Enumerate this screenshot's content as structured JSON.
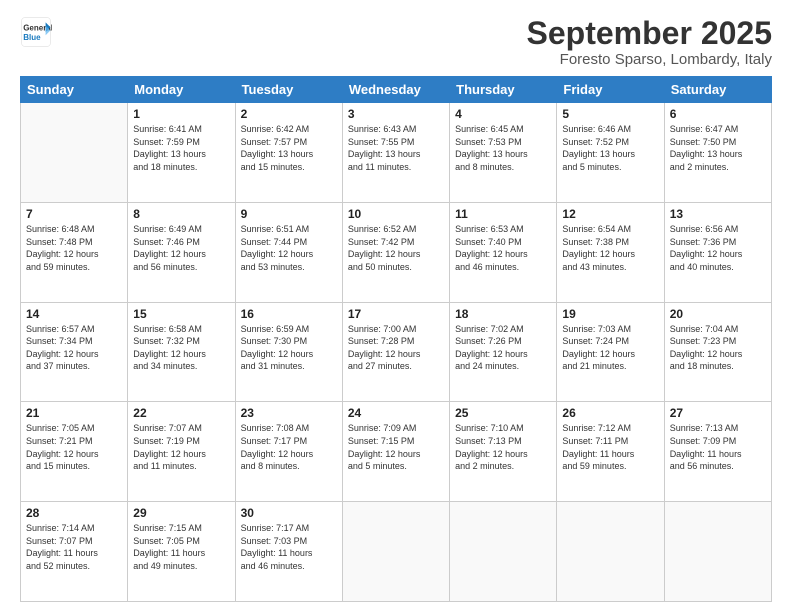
{
  "logo": {
    "text_general": "General",
    "text_blue": "Blue"
  },
  "header": {
    "title": "September 2025",
    "subtitle": "Foresto Sparso, Lombardy, Italy"
  },
  "weekdays": [
    "Sunday",
    "Monday",
    "Tuesday",
    "Wednesday",
    "Thursday",
    "Friday",
    "Saturday"
  ],
  "weeks": [
    [
      {
        "day": "",
        "info": ""
      },
      {
        "day": "1",
        "info": "Sunrise: 6:41 AM\nSunset: 7:59 PM\nDaylight: 13 hours\nand 18 minutes."
      },
      {
        "day": "2",
        "info": "Sunrise: 6:42 AM\nSunset: 7:57 PM\nDaylight: 13 hours\nand 15 minutes."
      },
      {
        "day": "3",
        "info": "Sunrise: 6:43 AM\nSunset: 7:55 PM\nDaylight: 13 hours\nand 11 minutes."
      },
      {
        "day": "4",
        "info": "Sunrise: 6:45 AM\nSunset: 7:53 PM\nDaylight: 13 hours\nand 8 minutes."
      },
      {
        "day": "5",
        "info": "Sunrise: 6:46 AM\nSunset: 7:52 PM\nDaylight: 13 hours\nand 5 minutes."
      },
      {
        "day": "6",
        "info": "Sunrise: 6:47 AM\nSunset: 7:50 PM\nDaylight: 13 hours\nand 2 minutes."
      }
    ],
    [
      {
        "day": "7",
        "info": "Sunrise: 6:48 AM\nSunset: 7:48 PM\nDaylight: 12 hours\nand 59 minutes."
      },
      {
        "day": "8",
        "info": "Sunrise: 6:49 AM\nSunset: 7:46 PM\nDaylight: 12 hours\nand 56 minutes."
      },
      {
        "day": "9",
        "info": "Sunrise: 6:51 AM\nSunset: 7:44 PM\nDaylight: 12 hours\nand 53 minutes."
      },
      {
        "day": "10",
        "info": "Sunrise: 6:52 AM\nSunset: 7:42 PM\nDaylight: 12 hours\nand 50 minutes."
      },
      {
        "day": "11",
        "info": "Sunrise: 6:53 AM\nSunset: 7:40 PM\nDaylight: 12 hours\nand 46 minutes."
      },
      {
        "day": "12",
        "info": "Sunrise: 6:54 AM\nSunset: 7:38 PM\nDaylight: 12 hours\nand 43 minutes."
      },
      {
        "day": "13",
        "info": "Sunrise: 6:56 AM\nSunset: 7:36 PM\nDaylight: 12 hours\nand 40 minutes."
      }
    ],
    [
      {
        "day": "14",
        "info": "Sunrise: 6:57 AM\nSunset: 7:34 PM\nDaylight: 12 hours\nand 37 minutes."
      },
      {
        "day": "15",
        "info": "Sunrise: 6:58 AM\nSunset: 7:32 PM\nDaylight: 12 hours\nand 34 minutes."
      },
      {
        "day": "16",
        "info": "Sunrise: 6:59 AM\nSunset: 7:30 PM\nDaylight: 12 hours\nand 31 minutes."
      },
      {
        "day": "17",
        "info": "Sunrise: 7:00 AM\nSunset: 7:28 PM\nDaylight: 12 hours\nand 27 minutes."
      },
      {
        "day": "18",
        "info": "Sunrise: 7:02 AM\nSunset: 7:26 PM\nDaylight: 12 hours\nand 24 minutes."
      },
      {
        "day": "19",
        "info": "Sunrise: 7:03 AM\nSunset: 7:24 PM\nDaylight: 12 hours\nand 21 minutes."
      },
      {
        "day": "20",
        "info": "Sunrise: 7:04 AM\nSunset: 7:23 PM\nDaylight: 12 hours\nand 18 minutes."
      }
    ],
    [
      {
        "day": "21",
        "info": "Sunrise: 7:05 AM\nSunset: 7:21 PM\nDaylight: 12 hours\nand 15 minutes."
      },
      {
        "day": "22",
        "info": "Sunrise: 7:07 AM\nSunset: 7:19 PM\nDaylight: 12 hours\nand 11 minutes."
      },
      {
        "day": "23",
        "info": "Sunrise: 7:08 AM\nSunset: 7:17 PM\nDaylight: 12 hours\nand 8 minutes."
      },
      {
        "day": "24",
        "info": "Sunrise: 7:09 AM\nSunset: 7:15 PM\nDaylight: 12 hours\nand 5 minutes."
      },
      {
        "day": "25",
        "info": "Sunrise: 7:10 AM\nSunset: 7:13 PM\nDaylight: 12 hours\nand 2 minutes."
      },
      {
        "day": "26",
        "info": "Sunrise: 7:12 AM\nSunset: 7:11 PM\nDaylight: 11 hours\nand 59 minutes."
      },
      {
        "day": "27",
        "info": "Sunrise: 7:13 AM\nSunset: 7:09 PM\nDaylight: 11 hours\nand 56 minutes."
      }
    ],
    [
      {
        "day": "28",
        "info": "Sunrise: 7:14 AM\nSunset: 7:07 PM\nDaylight: 11 hours\nand 52 minutes."
      },
      {
        "day": "29",
        "info": "Sunrise: 7:15 AM\nSunset: 7:05 PM\nDaylight: 11 hours\nand 49 minutes."
      },
      {
        "day": "30",
        "info": "Sunrise: 7:17 AM\nSunset: 7:03 PM\nDaylight: 11 hours\nand 46 minutes."
      },
      {
        "day": "",
        "info": ""
      },
      {
        "day": "",
        "info": ""
      },
      {
        "day": "",
        "info": ""
      },
      {
        "day": "",
        "info": ""
      }
    ]
  ]
}
